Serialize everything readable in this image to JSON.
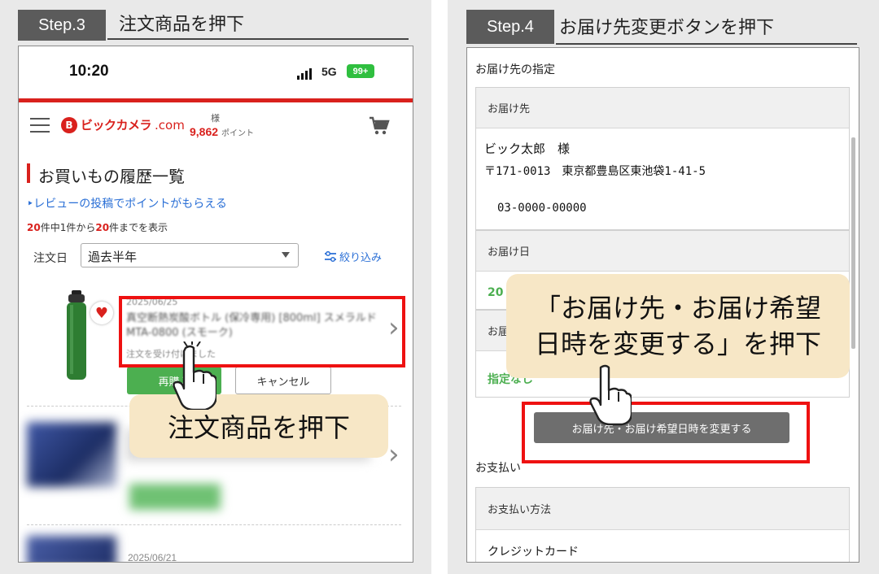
{
  "left": {
    "step_badge": "Step.3",
    "step_title": "注文商品を押下",
    "status_time": "10:20",
    "network": "5G",
    "battery": "99+",
    "logo_mark": "B",
    "logo_text": "ビックカメラ",
    "logo_domain": ".com",
    "user_suffix": "様",
    "points": "9,862",
    "points_unit": "ポイント",
    "section_title": "お買いもの履歴一覧",
    "review_link": "‣レビューの投稿でポイントがもらえる",
    "count_a": "20",
    "count_b": "件中1件から",
    "count_c": "20",
    "count_d": "件までを表示",
    "order_date_label": "注文日",
    "period_value": "過去半年",
    "filter_label": "絞り込み",
    "item1": {
      "date": "2025/06/25",
      "name": "真空断熱炭酸ボトル (保冷専用) [800ml] スメラルド MTA-0800 (スモーク)",
      "status": "注文を受け付けました",
      "button_green": "再購入",
      "button_cancel": "キャンセル"
    },
    "item2_date": "2025/06/21",
    "callout": "注文商品を押下"
  },
  "right": {
    "step_badge": "Step.4",
    "step_title": "お届け先変更ボタンを押下",
    "section_delivery": "お届け先の指定",
    "card1_head": "お届け先",
    "name": "ビック太郎　様",
    "address": "〒171-0013　東京都豊島区東池袋1-41-5",
    "phone": "03-0000-00000",
    "card2_head": "お届け日",
    "card2_value": "20",
    "card3_head": "お届",
    "card3_value": "指定なし",
    "change_button": "お届け先・お届け希望日時を変更する",
    "section_payment": "お支払い",
    "payment_head": "お支払い方法",
    "payment_value": "クレジットカード",
    "callout_line1": "「お届け先・お届け希望",
    "callout_line2": "日時を変更する」を押下"
  },
  "colors": {
    "brand_red": "#d9211d",
    "highlight_red": "#ee1111",
    "callout_bg": "#f7e7c6",
    "green": "#4caf50",
    "badge_grey": "#5b5b5b"
  }
}
